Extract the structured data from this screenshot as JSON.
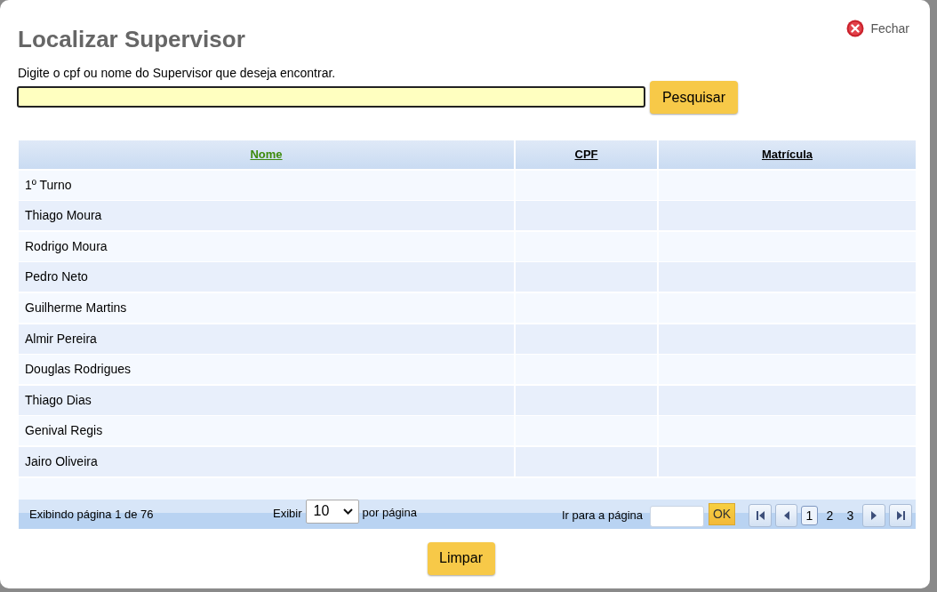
{
  "dialog": {
    "title": "Localizar Supervisor",
    "close_label": "Fechar"
  },
  "search": {
    "prompt": "Digite o cpf ou nome do Supervisor que deseja encontrar.",
    "button": "Pesquisar"
  },
  "table": {
    "columns": [
      {
        "label": "Nome",
        "sorted": true
      },
      {
        "label": "CPF",
        "sorted": false
      },
      {
        "label": "Matrícula",
        "sorted": false
      }
    ],
    "rows": [
      "1º Turno",
      "Thiago Moura",
      "Rodrigo Moura",
      "Pedro Neto",
      "Guilherme Martins",
      "Almir Pereira",
      "Douglas Rodrigues",
      "Thiago Dias",
      "Genival Regis",
      "Jairo Oliveira"
    ]
  },
  "pager": {
    "summary": "Exibindo página 1 de 76",
    "show_label": "Exibir",
    "page_size": "10",
    "per_page_label": "por página",
    "goto_label": "Ir para a página",
    "goto_button": "OK",
    "pages": [
      {
        "label": "1",
        "selected": true
      },
      {
        "label": "2",
        "selected": false
      },
      {
        "label": "3",
        "selected": false
      }
    ]
  },
  "buttons": [
    "Limpar"
  ]
}
